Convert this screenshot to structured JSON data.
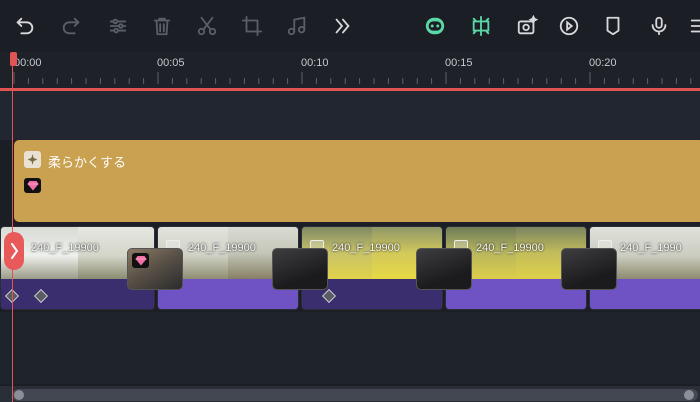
{
  "toolbar": {
    "icons": [
      "undo-icon",
      "redo-icon",
      "adjust-icon",
      "delete-icon",
      "cut-icon",
      "crop-icon",
      "audio-icon",
      "more-icon",
      "ai-robot-icon",
      "split-screen-icon",
      "camera-sparkle-icon",
      "play-circle-icon",
      "marker-icon",
      "microphone-icon",
      "list-icon"
    ],
    "accent": "#5ad8a6"
  },
  "ruler": {
    "labels": [
      "00:00",
      "00:05",
      "00:10",
      "00:15",
      "00:20"
    ],
    "playhead_color": "#e05454"
  },
  "effect_clip": {
    "label": "柔らかくする",
    "color": "#c9a150"
  },
  "video_clips": [
    {
      "label": "240_F_19900"
    },
    {
      "label": "240_F_19900"
    },
    {
      "label": "240_F_19900"
    },
    {
      "label": "240_F_19900"
    },
    {
      "label": "240_F_1990"
    }
  ],
  "colors": {
    "clip_lower": "#6f52c3",
    "background": "#1b1e24"
  }
}
